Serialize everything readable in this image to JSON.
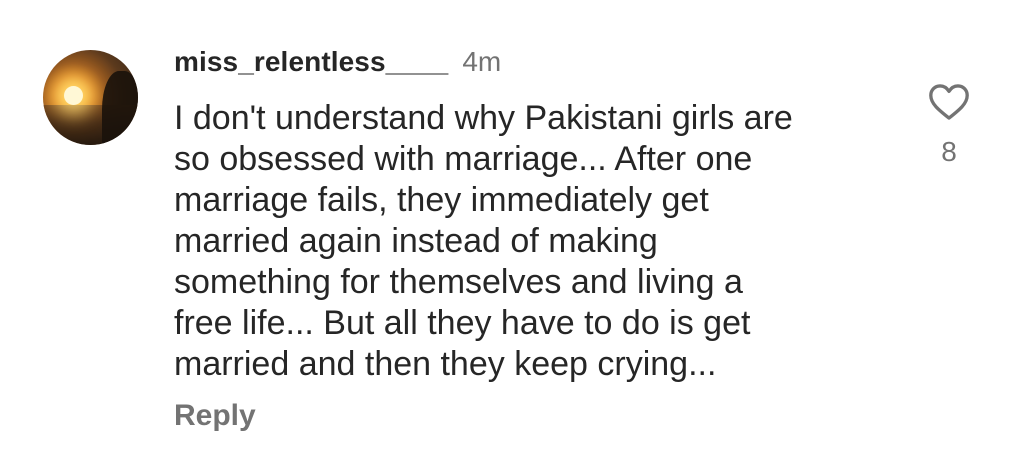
{
  "comment": {
    "username": "miss_relentless____",
    "timestamp": "4m",
    "text": "I don't understand why Pakistani girls are\nso obsessed with marriage... After one\nmarriage fails, they immediately get\nmarried again instead of making\nsomething for themselves and living a\nfree life... But all they have to do is get\nmarried and then they keep crying...",
    "reply_label": "Reply",
    "like_count": "8"
  },
  "icons": {
    "like": "heart-outline-icon",
    "avatar": "profile-avatar-sunset"
  },
  "colors": {
    "primary_text": "#262626",
    "secondary_text": "#737373",
    "background": "#ffffff"
  }
}
